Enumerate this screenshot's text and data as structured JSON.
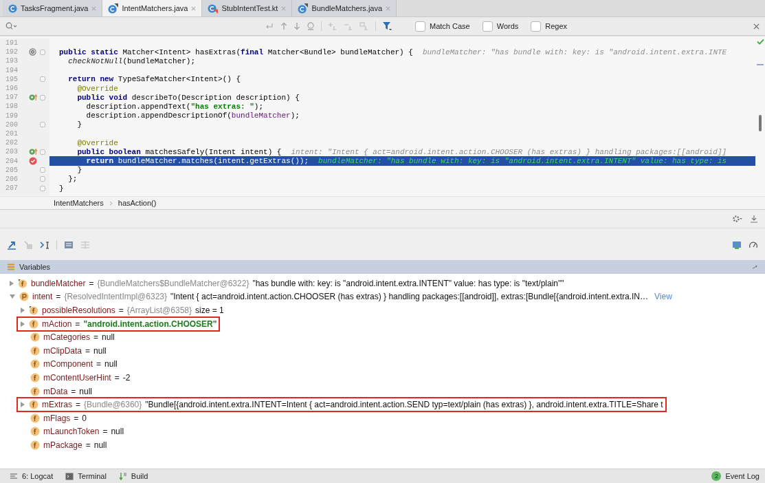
{
  "editor_tabs": [
    {
      "label": "TasksFragment.java",
      "selected": false,
      "kind": "class"
    },
    {
      "label": "IntentMatchers.java",
      "selected": true,
      "kind": "class-modified"
    },
    {
      "label": "StubIntentTest.kt",
      "selected": false,
      "kind": "kotlin"
    },
    {
      "label": "BundleMatchers.java",
      "selected": false,
      "kind": "class-modified"
    }
  ],
  "find_bar": {
    "options": [
      {
        "label": "Match Case",
        "checked": false
      },
      {
        "label": "Words",
        "checked": false
      },
      {
        "label": "Regex",
        "checked": false
      }
    ]
  },
  "code_lines": [
    {
      "number": "191",
      "kind": "plain",
      "fold": false,
      "current": false
    },
    {
      "number": "192",
      "kind": "override",
      "fold": true,
      "current": false,
      "tokens": [
        {
          "kind": "keyword",
          "t": "public static "
        },
        {
          "kind": "plain",
          "t": "Matcher<Intent> hasExtras("
        },
        {
          "kind": "keyword",
          "t": "final "
        },
        {
          "kind": "plain",
          "t": "Matcher<Bundle> bundleMatcher) {"
        }
      ],
      "hint": "bundleMatcher: \"has bundle with: key: is \"android.intent.extra.INTE"
    },
    {
      "number": "193",
      "kind": "plain",
      "fold": false,
      "current": false,
      "tokens": [
        {
          "kind": "italic",
          "t": "  checkNotNull"
        },
        {
          "kind": "plain",
          "t": "(bundleMatcher);"
        }
      ]
    },
    {
      "number": "194",
      "kind": "plain",
      "fold": false,
      "current": false
    },
    {
      "number": "195",
      "kind": "plain",
      "fold": true,
      "current": false,
      "tokens": [
        {
          "kind": "keyword",
          "t": "  return new "
        },
        {
          "kind": "plain",
          "t": "TypeSafeMatcher<Intent>() {"
        }
      ]
    },
    {
      "number": "196",
      "kind": "plain",
      "fold": false,
      "current": false,
      "tokens": [
        {
          "kind": "annotation",
          "t": "    @Override"
        }
      ]
    },
    {
      "number": "197",
      "kind": "implements",
      "fold": true,
      "current": false,
      "tokens": [
        {
          "kind": "keyword",
          "t": "    public void "
        },
        {
          "kind": "plain",
          "t": "describeTo(Description description) {"
        }
      ]
    },
    {
      "number": "198",
      "kind": "plain",
      "fold": false,
      "current": false,
      "tokens": [
        {
          "kind": "plain",
          "t": "      description.appendText("
        },
        {
          "kind": "string",
          "t": "\"has extras: \""
        },
        {
          "kind": "plain",
          "t": ");"
        }
      ]
    },
    {
      "number": "199",
      "kind": "plain",
      "fold": false,
      "current": false,
      "tokens": [
        {
          "kind": "plain",
          "t": "      description.appendDescriptionOf("
        },
        {
          "kind": "field",
          "t": "bundleMatcher"
        },
        {
          "kind": "plain",
          "t": ");"
        }
      ]
    },
    {
      "number": "200",
      "kind": "plain",
      "fold": true,
      "current": false,
      "tokens": [
        {
          "kind": "plain",
          "t": "    }"
        }
      ]
    },
    {
      "number": "201",
      "kind": "plain",
      "fold": false,
      "current": false
    },
    {
      "number": "202",
      "kind": "plain",
      "fold": false,
      "current": false,
      "tokens": [
        {
          "kind": "annotation",
          "t": "    @Override"
        }
      ]
    },
    {
      "number": "203",
      "kind": "implements",
      "fold": true,
      "current": false,
      "tokens": [
        {
          "kind": "keyword",
          "t": "    public boolean "
        },
        {
          "kind": "plain",
          "t": "matchesSafely(Intent intent) {"
        }
      ],
      "hint": "intent: \"Intent { act=android.intent.action.CHOOSER (has extras) } handling packages:[[android]]"
    },
    {
      "number": "204",
      "kind": "breakpoint",
      "fold": false,
      "current": true,
      "tokens": [
        {
          "kind": "keyword",
          "t": "      return "
        },
        {
          "kind": "plain",
          "t": "bundleMatcher.matches(intent.getExtras());"
        }
      ],
      "hint": "bundleMatcher: \"has bundle with: key: is \"android.intent.extra.INTENT\" value: has type: is"
    },
    {
      "number": "205",
      "kind": "plain",
      "fold": true,
      "current": false,
      "tokens": [
        {
          "kind": "plain",
          "t": "    }"
        }
      ]
    },
    {
      "number": "206",
      "kind": "plain",
      "fold": true,
      "current": false,
      "tokens": [
        {
          "kind": "plain",
          "t": "  };"
        }
      ]
    },
    {
      "number": "207",
      "kind": "plain",
      "fold": true,
      "current": false,
      "tokens": [
        {
          "kind": "plain",
          "t": "}"
        }
      ]
    }
  ],
  "breadcrumb": [
    "IntentMatchers",
    "hasAction()"
  ],
  "variables_panel": {
    "title": "Variables",
    "variables": [
      {
        "name": "bundleMatcher",
        "kind": "final-field",
        "expanded": false,
        "highlighted": false,
        "equals": "=",
        "ref": "{BundleMatchers$BundleMatcher@6322}",
        "value": "\"has bundle with: key: is \"android.intent.extra.INTENT\" value: has type: is \"text/plain\"\"",
        "string_value": false
      },
      {
        "name": "intent",
        "kind": "param",
        "expanded": true,
        "highlighted": false,
        "equals": "=",
        "ref": "{ResolvedIntentImpl@6323}",
        "value": "\"Intent { act=android.intent.action.CHOOSER (has extras) } handling packages:[[android]], extras:[Bundle[{android.intent.extra.IN…",
        "string_value": false,
        "link": "View",
        "children": [
          {
            "name": "possibleResolutions",
            "kind": "final-field",
            "expanded": false,
            "highlighted": false,
            "equals": "=",
            "ref": "{ArrayList@6358}",
            "value": "size = 1",
            "string_value": false
          },
          {
            "name": "mAction",
            "kind": "field",
            "expanded": false,
            "highlighted": true,
            "equals": "=",
            "value": "\"android.intent.action.CHOOSER\"",
            "string_value": true
          },
          {
            "name": "mCategories",
            "kind": "field",
            "highlighted": false,
            "equals": "=",
            "value": "null",
            "string_value": false
          },
          {
            "name": "mClipData",
            "kind": "field",
            "highlighted": false,
            "equals": "=",
            "value": "null",
            "string_value": false
          },
          {
            "name": "mComponent",
            "kind": "field",
            "highlighted": false,
            "equals": "=",
            "value": "null",
            "string_value": false
          },
          {
            "name": "mContentUserHint",
            "kind": "field",
            "highlighted": false,
            "equals": "=",
            "value": "-2",
            "string_value": false
          },
          {
            "name": "mData",
            "kind": "field",
            "highlighted": false,
            "equals": "=",
            "value": "null",
            "string_value": false
          },
          {
            "name": "mExtras",
            "kind": "field",
            "expanded": false,
            "highlighted": true,
            "equals": "=",
            "ref": "{Bundle@6360}",
            "value": "\"Bundle[{android.intent.extra.INTENT=Intent { act=android.intent.action.SEND typ=text/plain (has extras) }, android.intent.extra.TITLE=Share t",
            "string_value": false
          },
          {
            "name": "mFlags",
            "kind": "field",
            "highlighted": false,
            "equals": "=",
            "value": "0",
            "string_value": false
          },
          {
            "name": "mLaunchToken",
            "kind": "field",
            "highlighted": false,
            "equals": "=",
            "value": "null",
            "string_value": false
          },
          {
            "name": "mPackage",
            "kind": "field",
            "highlighted": false,
            "equals": "=",
            "value": "null",
            "string_value": false
          }
        ]
      }
    ]
  },
  "status_bar": {
    "left": [
      {
        "kind": "logcat",
        "label": "6: Logcat"
      },
      {
        "kind": "terminal",
        "label": "Terminal"
      },
      {
        "kind": "build",
        "label": "Build"
      }
    ],
    "event_log": {
      "count": "2",
      "label": "Event Log"
    }
  }
}
